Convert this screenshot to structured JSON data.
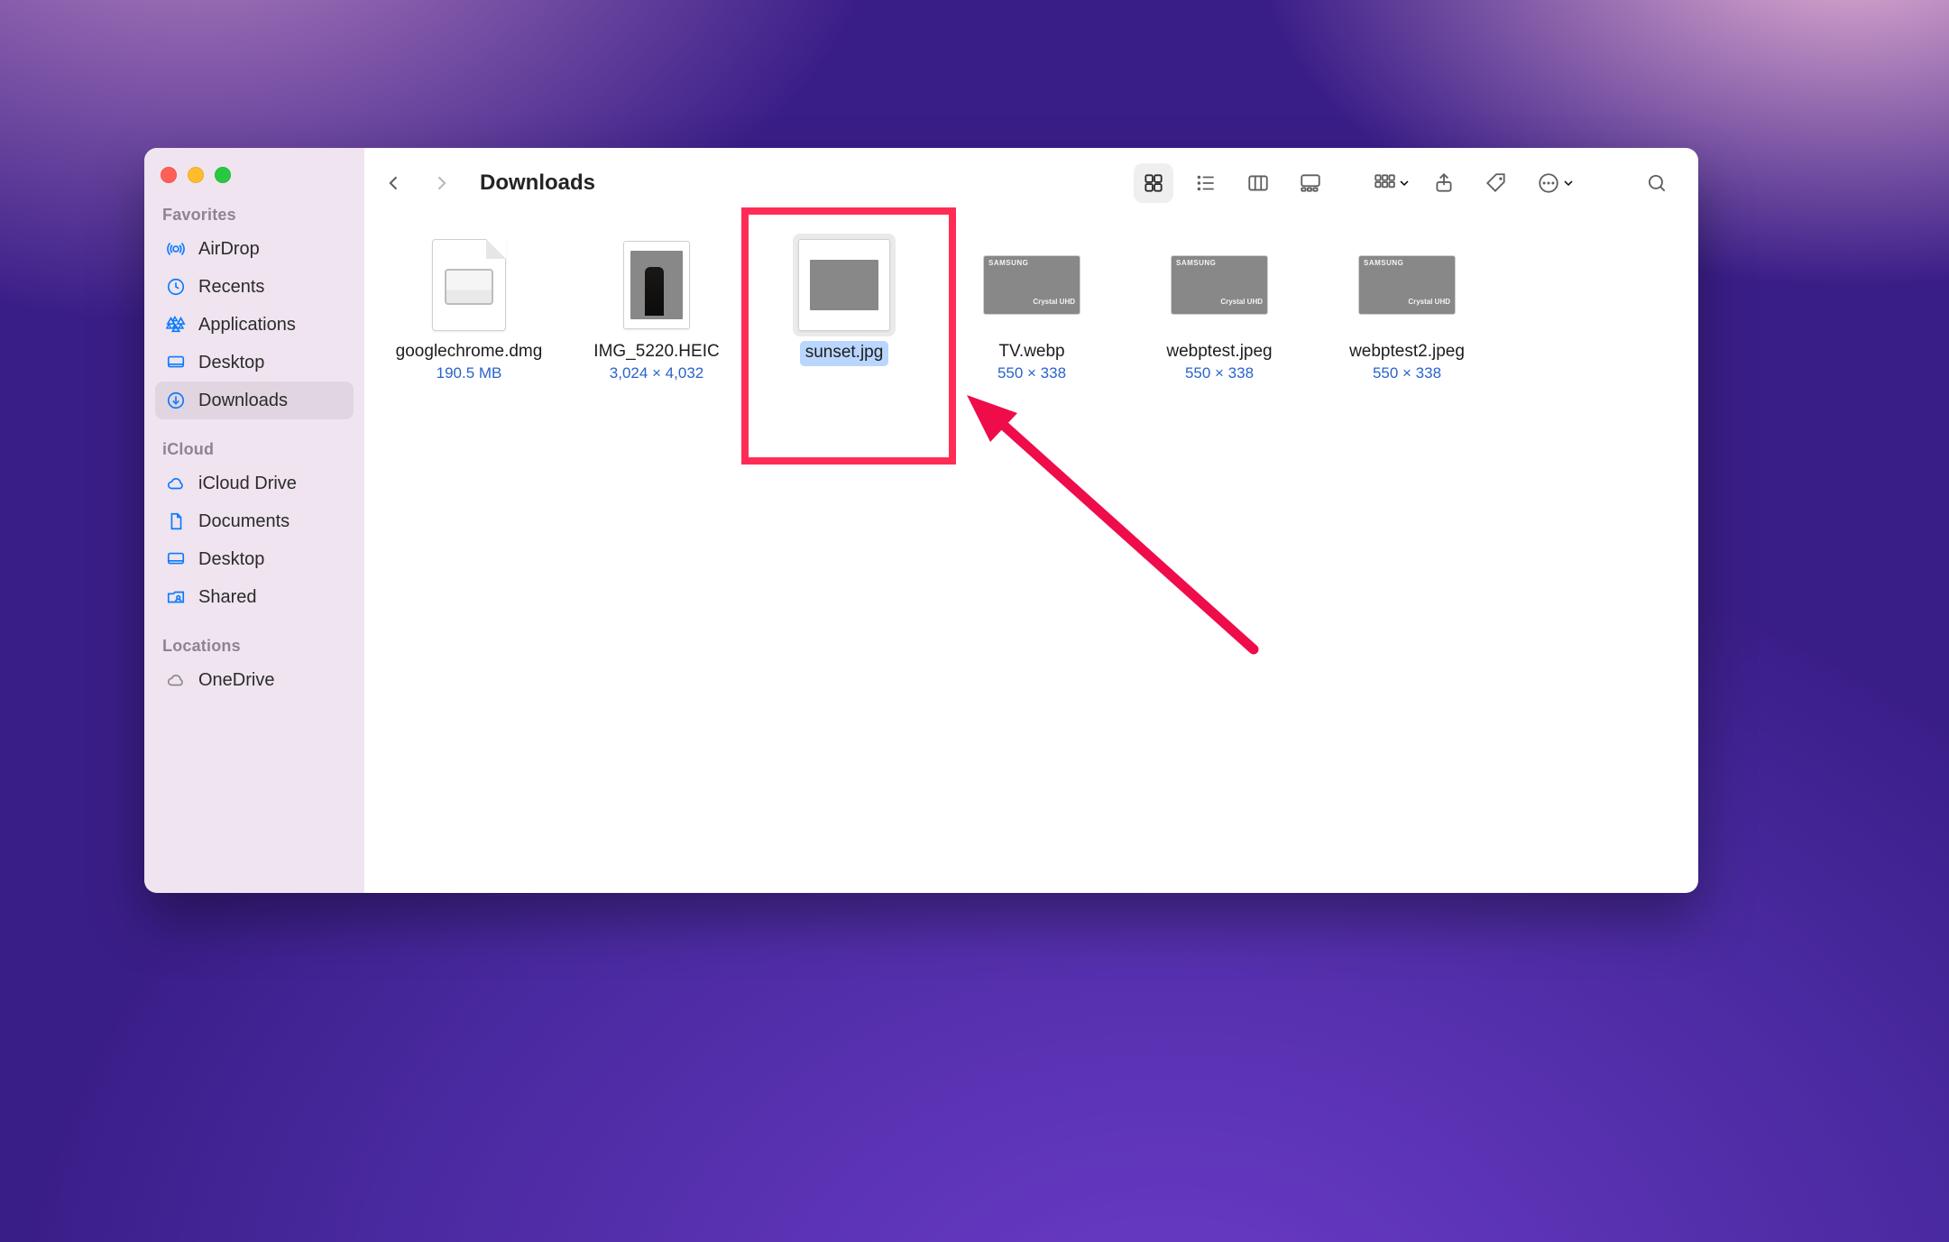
{
  "window": {
    "title": "Downloads"
  },
  "sidebar": {
    "sections": [
      {
        "heading": "Favorites",
        "items": [
          {
            "icon": "airdrop-icon",
            "label": "AirDrop"
          },
          {
            "icon": "clock-icon",
            "label": "Recents"
          },
          {
            "icon": "apps-icon",
            "label": "Applications"
          },
          {
            "icon": "desktop-icon",
            "label": "Desktop"
          },
          {
            "icon": "downloads-icon",
            "label": "Downloads",
            "selected": true
          }
        ]
      },
      {
        "heading": "iCloud",
        "items": [
          {
            "icon": "cloud-icon",
            "label": "iCloud Drive"
          },
          {
            "icon": "doc-icon",
            "label": "Documents"
          },
          {
            "icon": "desktop-icon",
            "label": "Desktop"
          },
          {
            "icon": "shared-icon",
            "label": "Shared"
          }
        ]
      },
      {
        "heading": "Locations",
        "items": [
          {
            "icon": "cloud-grey-icon",
            "label": "OneDrive"
          }
        ]
      }
    ]
  },
  "toolbar": {
    "back_enabled": true,
    "forward_enabled": false,
    "view_mode": "icons",
    "buttons": [
      "view-icons",
      "view-list",
      "view-columns",
      "view-gallery",
      "group",
      "share",
      "tags",
      "actions",
      "search"
    ]
  },
  "files": [
    {
      "name": "googlechrome.dmg",
      "meta": "190.5 MB",
      "kind": "dmg"
    },
    {
      "name": "IMG_5220.HEIC",
      "meta": "3,024 × 4,032",
      "kind": "heic"
    },
    {
      "name": "sunset.jpg",
      "meta": "",
      "kind": "jpg",
      "selected": true
    },
    {
      "name": "TV.webp",
      "meta": "550 × 338",
      "kind": "webp"
    },
    {
      "name": "webptest.jpeg",
      "meta": "550 × 338",
      "kind": "jpeg"
    },
    {
      "name": "webptest2.jpeg",
      "meta": "550 × 338",
      "kind": "jpeg"
    }
  ],
  "annotation": {
    "highlight_target": "sunset.jpg",
    "arrow": true
  }
}
